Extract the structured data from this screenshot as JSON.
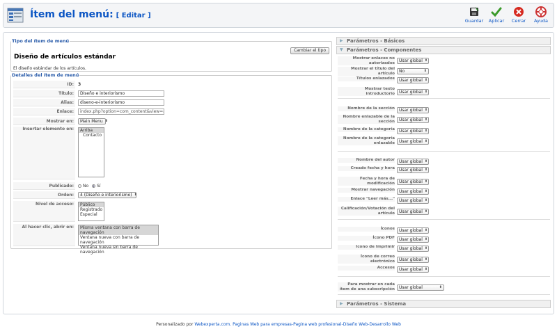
{
  "header": {
    "title": "Ítem del menú:",
    "edit": "[ Editar ]",
    "tools": [
      {
        "label": "Guardar",
        "icon": "save-icon"
      },
      {
        "label": "Aplicar",
        "icon": "apply-check-icon"
      },
      {
        "label": "Cerrar",
        "icon": "close-icon"
      },
      {
        "label": "Ayuda",
        "icon": "help-lifebuoy-icon"
      }
    ]
  },
  "type_section": {
    "legend": "Tipo del ítem de menú",
    "title": "Diseño de artículos estándar",
    "description": "El diseño estándar de los artículos.",
    "change_button": "Cambiar el tipo"
  },
  "details": {
    "legend": "Detalles del ítem de menú",
    "id_label": "ID:",
    "id_value": "3",
    "title_label": "Título:",
    "title_value": "Diseño e interiorismo",
    "alias_label": "Alias:",
    "alias_value": "diseno-e-interiorismo",
    "link_label": "Enlace:",
    "link_value": "index.php?option=com_content&view=artícu",
    "show_in_label": "Mostrar en:",
    "show_in_value": "Main Menu",
    "insert_label": "Insertar elemento en:",
    "insert_options": [
      "Arriba",
      "Contacto"
    ],
    "published_label": "Publicado:",
    "published_no": "No",
    "published_yes": "Sí",
    "order_label": "Orden:",
    "order_value": "4 (Diseño e interiorismo)",
    "access_label": "Nivel de acceso:",
    "access_options": [
      "Público",
      "Registrado",
      "Especial"
    ],
    "click_label": "Al hacer clic, abrir en:",
    "click_options": [
      "Misma ventana con barra de navegación",
      "Ventana nueva con barra de navegación",
      "Ventana nueva sin barra de navegación"
    ]
  },
  "params": {
    "basic": "Parámetros - Básicos",
    "components": "Parámetros - Componentes",
    "system": "Parámetros - Sistema",
    "rows": [
      {
        "label": "Mostrar enlaces no autorizados",
        "value": "Usar global"
      },
      {
        "label": "Mostrar el título del artículo",
        "value": "No"
      },
      {
        "label": "Títulos enlazados",
        "value": "Usar global"
      },
      {
        "label": "Mostrar texto introductorio",
        "value": "Usar global"
      },
      {
        "label": "Nombre de la sección",
        "value": "Usar global"
      },
      {
        "label": "Nombre enlazable de la sección",
        "value": "Usar global"
      },
      {
        "label": "Nombre de la categoría",
        "value": "Usar global"
      },
      {
        "label": "Nombre de la categoría enlazable",
        "value": "Usar global"
      },
      {
        "label": "Nombre del autor",
        "value": "Usar global"
      },
      {
        "label": "Creado fecha y hora",
        "value": "Usar global"
      },
      {
        "label": "Fecha y hora de modificación",
        "value": "Usar global"
      },
      {
        "label": "Mostrar navegación",
        "value": "Usar global"
      },
      {
        "label": "Enlace \"Leer más...\"",
        "value": "Usar global"
      },
      {
        "label": "Calificación/Votación del artículo",
        "value": "Usar global"
      },
      {
        "label": "Íconos",
        "value": "Usar global"
      },
      {
        "label": "Ícono PDF",
        "value": "Usar global"
      },
      {
        "label": "Icono de Imprimir",
        "value": "Usar global"
      },
      {
        "label": "Ícono de correo electrónico",
        "value": "Usar global"
      },
      {
        "label": "Accesos",
        "value": "Usar global"
      },
      {
        "label": "Para mostrar en cada ítem de una subscripción",
        "value": "Usar global"
      }
    ]
  },
  "footer": {
    "prefix": "Personalizado por ",
    "link": "Webexperta.com. Paginas Web para empresas-Pagina web profesional-Diseño Web-Desarrollo Web"
  }
}
